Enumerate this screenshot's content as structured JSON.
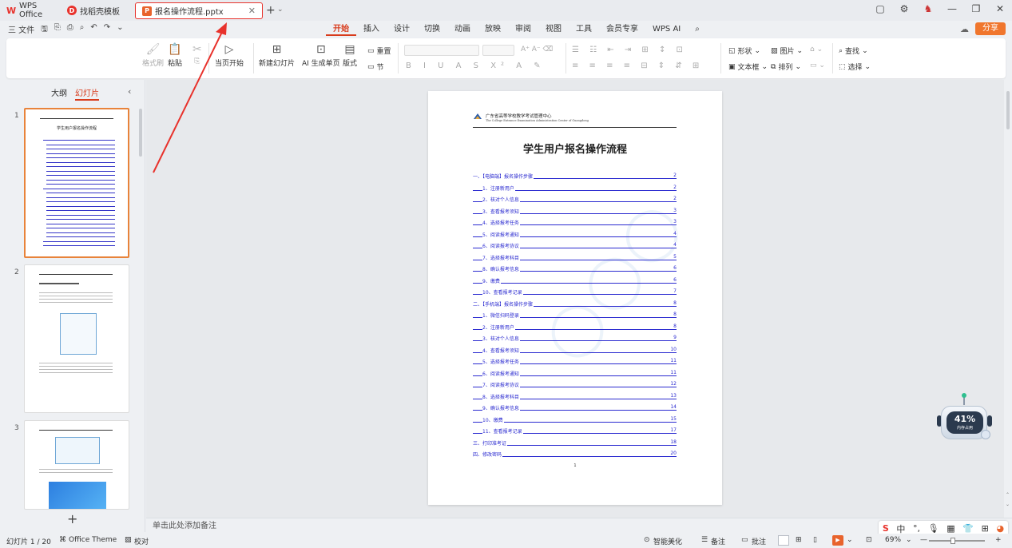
{
  "titlebar": {
    "tabs": [
      {
        "label": "WPS Office",
        "icon": "wps-logo-icon"
      },
      {
        "label": "找稻壳模板",
        "icon": "docer-icon"
      },
      {
        "label": "报名操作流程.pptx",
        "icon": "pptx-file-icon",
        "active": true
      }
    ]
  },
  "menubar": {
    "file_label": "三 文件",
    "items": [
      "开始",
      "插入",
      "设计",
      "切换",
      "动画",
      "放映",
      "审阅",
      "视图",
      "工具",
      "会员专享",
      "WPS AI"
    ],
    "active_item": "开始",
    "share_label": "分享"
  },
  "ribbon": {
    "format_painter": "格式刷",
    "paste": "粘贴",
    "play_from_current": "当页开始",
    "new_slide": "新建幻灯片",
    "ai_slide": "AI 生成单页",
    "layout": "版式",
    "reset": "重置",
    "section": "节",
    "shape": "形状",
    "picture": "图片",
    "textbox": "文本框",
    "arrange": "排列",
    "find": "查找",
    "select": "选择"
  },
  "left_panel": {
    "tab_outline": "大纲",
    "tab_slides": "幻灯片",
    "slide_numbers": [
      "1",
      "2",
      "3"
    ],
    "thumb1_title": "学生用户报名操作流程"
  },
  "slide": {
    "org_name": "广东省高等学校教学考试管理中心",
    "org_name_en": "The College Entrance Examination Administration Center of Guangdong",
    "title": "学生用户报名操作流程",
    "toc": [
      {
        "text": "一、【电脑端】报名操作步骤",
        "page": "2",
        "level": 1
      },
      {
        "text": "1、注册新用户",
        "page": "2",
        "level": 2
      },
      {
        "text": "2、核对个人信息",
        "page": "2",
        "level": 2
      },
      {
        "text": "3、查看报考须知",
        "page": "3",
        "level": 2
      },
      {
        "text": "4、选择报考任务",
        "page": "3",
        "level": 2
      },
      {
        "text": "5、阅读报考通知",
        "page": "4",
        "level": 2
      },
      {
        "text": "6、阅读报考协议",
        "page": "4",
        "level": 2
      },
      {
        "text": "7、选择报考科目",
        "page": "5",
        "level": 2
      },
      {
        "text": "8、确认报考信息",
        "page": "6",
        "level": 2
      },
      {
        "text": "9、缴费",
        "page": "6",
        "level": 2
      },
      {
        "text": "10、查看报考记录",
        "page": "7",
        "level": 2
      },
      {
        "text": "二、【手机端】报名操作步骤",
        "page": "8",
        "level": 1
      },
      {
        "text": "1、微信扫码登录",
        "page": "8",
        "level": 2
      },
      {
        "text": "2、注册新用户",
        "page": "8",
        "level": 2
      },
      {
        "text": "3、核对个人信息",
        "page": "9",
        "level": 2
      },
      {
        "text": "4、查看报考须知",
        "page": "10",
        "level": 2
      },
      {
        "text": "5、选择报考任务",
        "page": "11",
        "level": 2
      },
      {
        "text": "6、阅读报考通知",
        "page": "11",
        "level": 2
      },
      {
        "text": "7、阅读报考协议",
        "page": "12",
        "level": 2
      },
      {
        "text": "8、选择报考科目",
        "page": "13",
        "level": 2
      },
      {
        "text": "9、确认报考信息",
        "page": "14",
        "level": 2
      },
      {
        "text": "10、缴费",
        "page": "15",
        "level": 2
      },
      {
        "text": "11、查看报考记录",
        "page": "17",
        "level": 2
      },
      {
        "text": "三、打印准考证",
        "page": "18",
        "level": 1
      },
      {
        "text": "四、修改密码",
        "page": "20",
        "level": 1
      }
    ],
    "page_number": "1"
  },
  "robot": {
    "percent": "41%",
    "label": "内存占用"
  },
  "notes_placeholder": "单击此处添加备注",
  "status": {
    "slide_counter": "幻灯片 1 / 20",
    "theme": "Office Theme",
    "proofread": "校对",
    "beautify": "智能美化",
    "notes": "备注",
    "comments": "批注",
    "zoom": "69%"
  },
  "ime": {
    "mode": "中"
  }
}
